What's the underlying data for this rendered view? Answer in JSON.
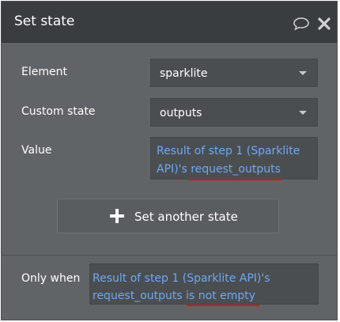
{
  "dialog": {
    "title": "Set state",
    "icons": {
      "comment": "comment-icon",
      "close": "close-icon"
    }
  },
  "fields": {
    "element": {
      "label": "Element",
      "value": "sparklite"
    },
    "custom_state": {
      "label": "Custom state",
      "value": "outputs"
    },
    "value": {
      "label": "Value",
      "expression_lines": [
        "Result of step 1 (Sparklite",
        "API)'s request_outputs"
      ]
    }
  },
  "set_another_button": {
    "label": "Set another state",
    "icon": "plus-icon"
  },
  "only_when": {
    "label": "Only when",
    "expression_lines": [
      "Result of step 1 (Sparklite API)'s",
      "request_outputs is not empty"
    ]
  },
  "colors": {
    "header_bg": "#3a3d40",
    "panel_bg": "#616467",
    "field_bg": "#4b4e51",
    "expression_text": "#6ea8f0",
    "annotation_underline": "#cc1b1b"
  }
}
